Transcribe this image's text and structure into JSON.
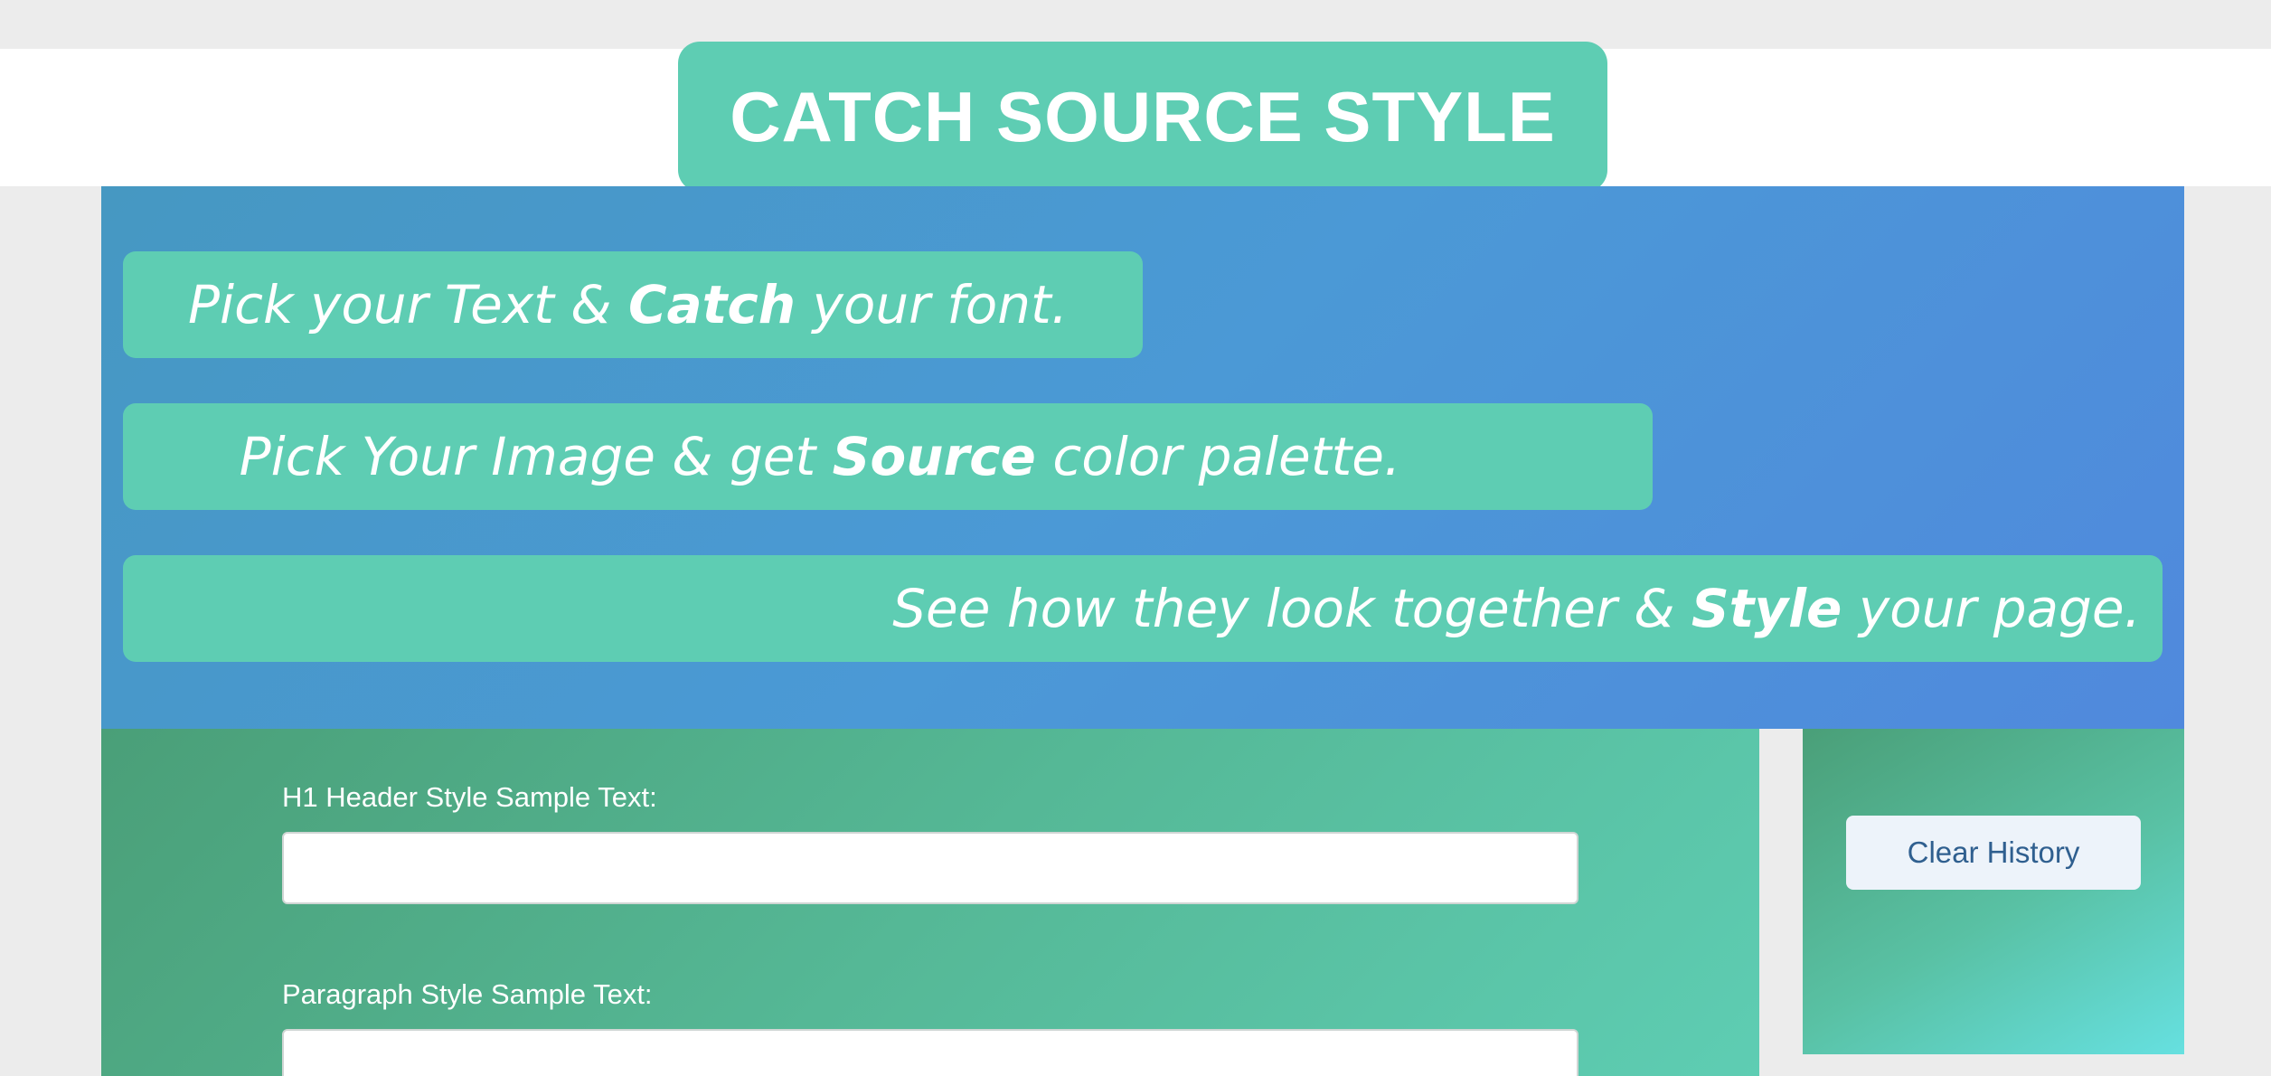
{
  "header": {
    "title": "CATCH SOURCE STYLE"
  },
  "hero": {
    "taglines": [
      {
        "before": "Pick your Text & ",
        "bold": "Catch",
        "after": " your font."
      },
      {
        "before": "Pick Your Image & get ",
        "bold": "Source",
        "after": " color palette."
      },
      {
        "before": "See how they look together & ",
        "bold": "Style",
        "after": " your page."
      }
    ]
  },
  "form": {
    "h1_label": "H1 Header Style Sample Text:",
    "h1_value": "",
    "paragraph_label": "Paragraph Style Sample Text:",
    "paragraph_value": ""
  },
  "sidebar": {
    "clear_history_label": "Clear History"
  },
  "colors": {
    "accent_green": "#5ecdb3",
    "hero_blue": "#4b99d6",
    "panel_green": "#4a9f78",
    "button_text": "#2f5f8f"
  }
}
